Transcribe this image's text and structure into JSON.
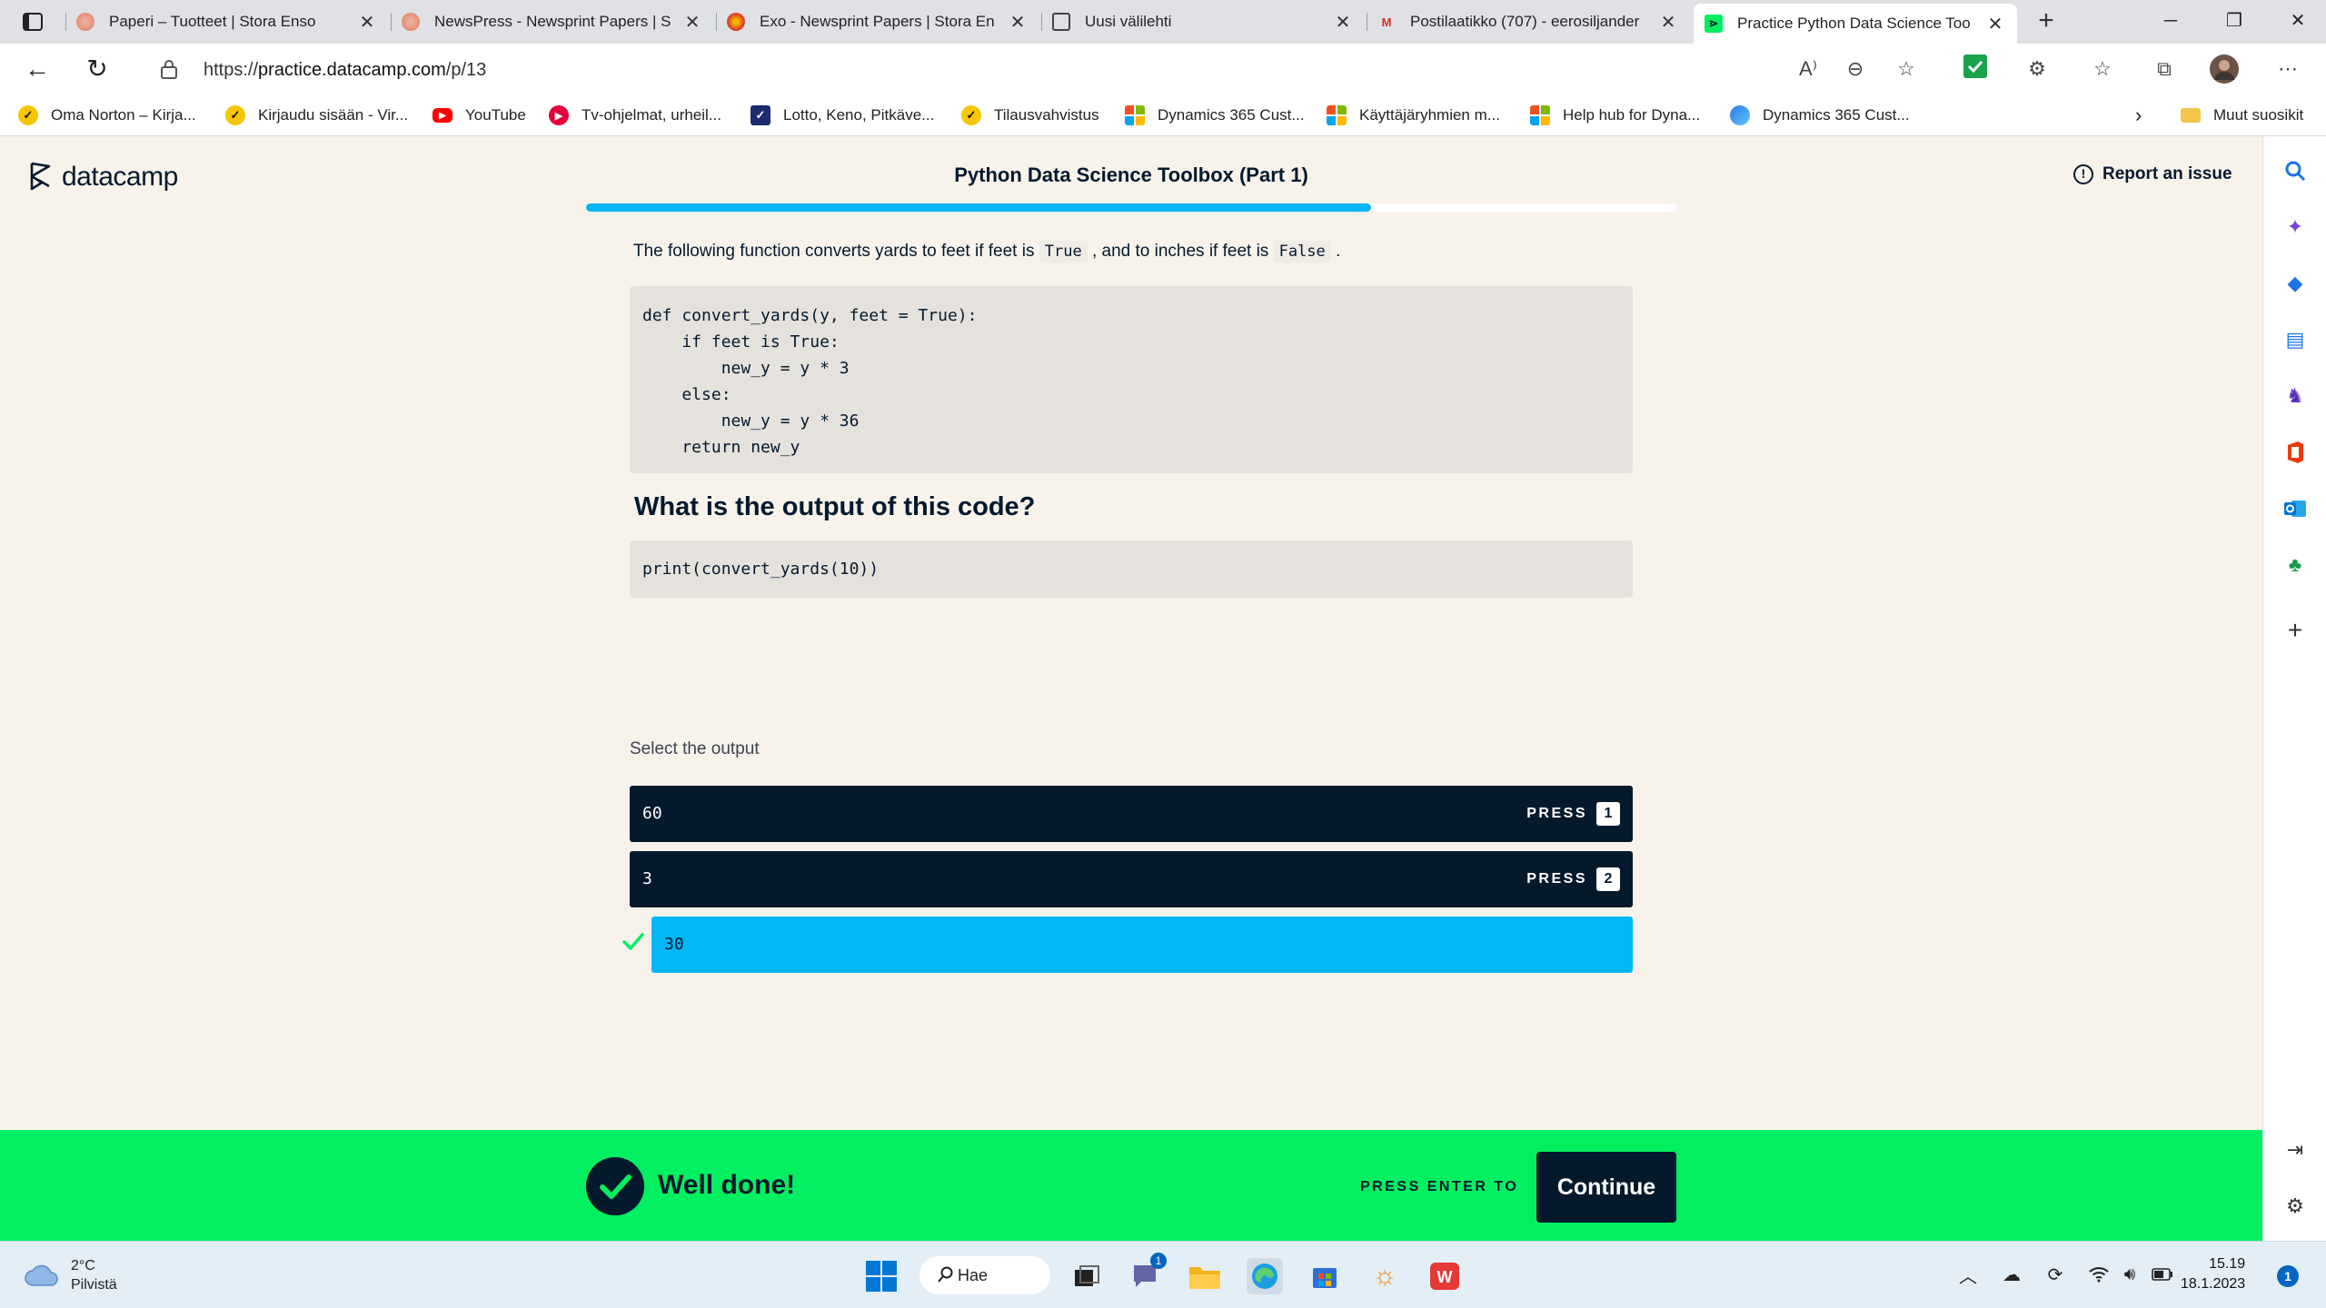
{
  "browser": {
    "tabs": [
      {
        "title": "Paperi – Tuotteet | Stora Enso",
        "icon": "stora-enso-icon",
        "color": "#e8a08a"
      },
      {
        "title": "NewsPress - Newsprint Papers | S",
        "icon": "stora-enso-icon",
        "color": "#e8a08a"
      },
      {
        "title": "Exo - Newsprint Papers | Stora En",
        "icon": "stora-enso-icon",
        "color": "#d9432b"
      },
      {
        "title": "Uusi välilehti",
        "icon": "new-tab-icon",
        "color": "#555555"
      },
      {
        "title": "Postilaatikko (707) - eerosiljander",
        "icon": "gmail-icon",
        "color": "#d93025"
      },
      {
        "title": "Practice Python Data Science Too",
        "icon": "datacamp-icon",
        "color": "#03ef62"
      }
    ],
    "url_prefix": "https://",
    "url_domain": "practice.datacamp.com",
    "url_path": "/p/13",
    "bookmarks": [
      {
        "label": "Oma Norton – Kirja...",
        "icon": "norton-icon",
        "color": "#f7c600"
      },
      {
        "label": "Kirjaudu sisään - Vir...",
        "icon": "norton-icon",
        "color": "#f7c600"
      },
      {
        "label": "YouTube",
        "icon": "youtube-icon",
        "color": "#ff0000"
      },
      {
        "label": "Tv-ohjelmat, urheil...",
        "icon": "ruutu-icon",
        "color": "#e4003a"
      },
      {
        "label": "Lotto, Keno, Pitkäve...",
        "icon": "veikkaus-icon",
        "color": "#1b2c6f"
      },
      {
        "label": "Tilausvahvistus",
        "icon": "norton-icon",
        "color": "#f7c600"
      },
      {
        "label": "Dynamics 365 Cust...",
        "icon": "microsoft-icon",
        "color": "#f25022"
      },
      {
        "label": "Käyttäjäryhmien m...",
        "icon": "microsoft-icon",
        "color": "#f25022"
      },
      {
        "label": "Help hub for Dyna...",
        "icon": "microsoft-icon",
        "color": "#f25022"
      },
      {
        "label": "Dynamics 365 Cust...",
        "icon": "dynamics-icon",
        "color": "#2a7de1"
      }
    ],
    "other_favorites": "Muut suosikit"
  },
  "page": {
    "logo_text": "datacamp",
    "course_title": "Python Data Science Toolbox (Part 1)",
    "report_label": "Report an issue",
    "progress": 0.72,
    "intro_part1": "The following function converts yards to feet if feet is",
    "intro_code1": "True",
    "intro_part2": ", and to inches if feet is",
    "intro_code2": "False",
    "intro_part3": ".",
    "code": "def convert_yards(y, feet = True):\n    if feet is True:\n        new_y = y * 3\n    else:\n        new_y = y * 36\n    return new_y",
    "question": "What is the output of this code?",
    "print_code": "print(convert_yards(10))",
    "select_label": "Select the output",
    "press_label": "PRESS",
    "options": [
      {
        "value": "60",
        "key": "1"
      },
      {
        "value": "3",
        "key": "2"
      },
      {
        "value": "30",
        "key": "3"
      }
    ],
    "feedback_text": "Well done!",
    "feedback_hint": "PRESS ENTER TO",
    "continue_label": "Continue"
  },
  "colors": {
    "accent_green": "#03ef62",
    "accent_blue": "#03b6f4",
    "navy": "#05192d"
  },
  "taskbar": {
    "temperature": "2°C",
    "weather": "Pilvistä",
    "search_label": "Hae",
    "teams_badge": "1",
    "time": "15.19",
    "date": "18.1.2023",
    "notifications": "1"
  }
}
